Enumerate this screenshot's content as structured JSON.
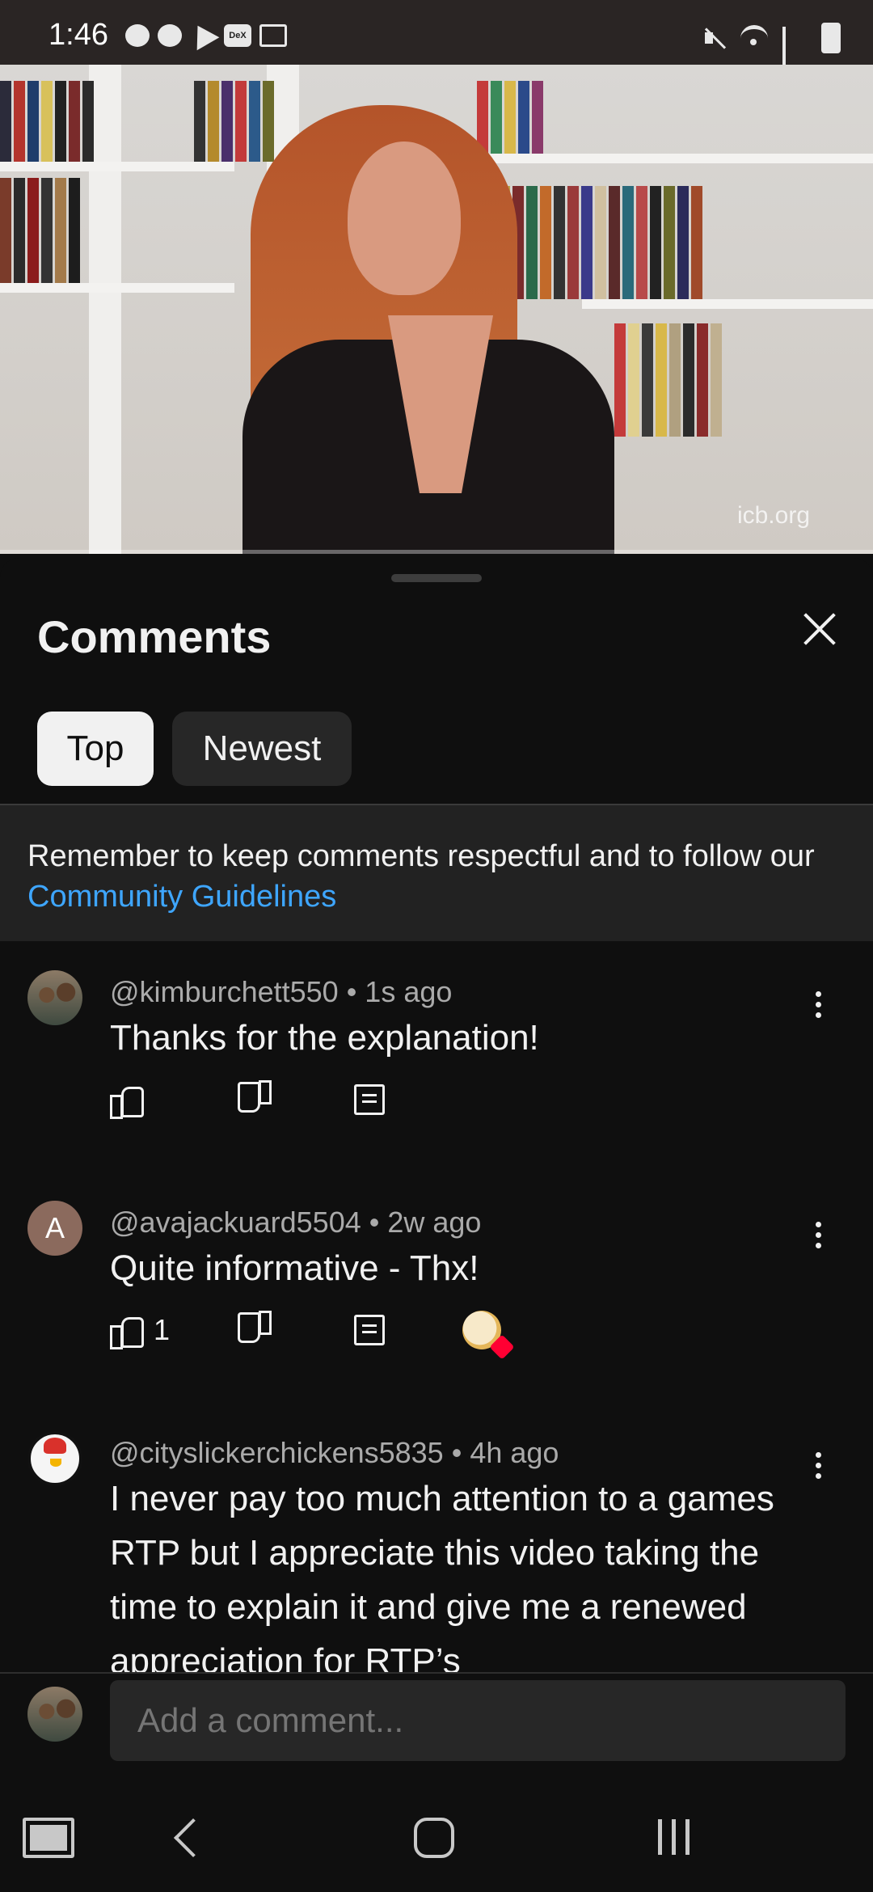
{
  "status_bar": {
    "time": "1:46",
    "left_icons": [
      "chat-bubble-icon",
      "messenger-icon",
      "telegram-icon",
      "dex-icon",
      "calendar-icon"
    ],
    "dex_label": "DeX",
    "right_icons": [
      "mute-icon",
      "wifi-icon",
      "signal-icon",
      "battery-charging-icon"
    ]
  },
  "video": {
    "watermark": "icb.org"
  },
  "sheet": {
    "title": "Comments",
    "filters": [
      {
        "label": "Top",
        "selected": true
      },
      {
        "label": "Newest",
        "selected": false
      }
    ],
    "notice": {
      "text": "Remember to keep comments respectful and to follow our",
      "link": "Community Guidelines"
    },
    "comments": [
      {
        "avatar": "photo",
        "author": "@kimburchett550",
        "time": "1s ago",
        "text": "Thanks for the explanation!",
        "likes": ""
      },
      {
        "avatar_letter": "A",
        "author": "@avajackuard5504",
        "time": "2w ago",
        "text": "Quite informative - Thx!",
        "likes": "1",
        "creator_hearted": true
      },
      {
        "avatar": "chicken",
        "author": "@cityslickerchickens5835",
        "time": "4h ago",
        "text": "I never pay too much attention to a games RTP but I appreciate this video taking the time to explain it and give me a renewed appreciation for RTP’s"
      }
    ],
    "add_comment": {
      "placeholder": "Add a comment..."
    }
  },
  "colors": {
    "background": "#0f0f0f",
    "link": "#3ea6ff",
    "heart": "#ff0033",
    "chip_selected": "#f1f1f1",
    "chip": "#272727"
  }
}
